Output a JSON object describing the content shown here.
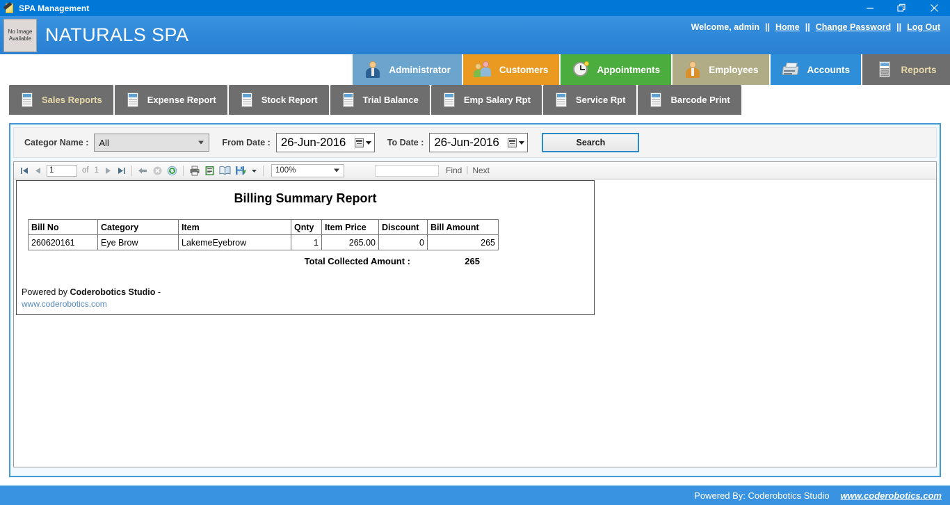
{
  "window": {
    "title": "SPA Management",
    "icon": "notepad-pencil-icon",
    "controls": {
      "minimize": "minimize-icon",
      "restore": "restore-icon",
      "close": "close-icon"
    }
  },
  "header": {
    "logo_placeholder_line1": "No Image",
    "logo_placeholder_line2": "Available",
    "brand": "NATURALS SPA",
    "welcome": "Welcome, admin",
    "sep1": "||",
    "sep2": "||",
    "sep3": "||",
    "links": [
      {
        "label": "Home"
      },
      {
        "label": "Change Password"
      },
      {
        "label": "Log Out"
      }
    ]
  },
  "main_nav": {
    "items": [
      {
        "label": "Administrator",
        "color": "#6ba5cd",
        "icon": "user-suit-icon",
        "active": false
      },
      {
        "label": "Customers",
        "color": "#eb9a21",
        "icon": "people-group-icon",
        "active": false
      },
      {
        "label": "Appointments",
        "color": "#4bad3e",
        "icon": "clock-icon",
        "active": false
      },
      {
        "label": "Employees",
        "color": "#b0ad86",
        "icon": "employee-icon",
        "active": false
      },
      {
        "label": "Accounts",
        "color": "#2f8ed8",
        "icon": "cash-register-icon",
        "active": false
      },
      {
        "label": "Reports",
        "color": "#6e6e6e",
        "icon": "report-doc-icon",
        "active": true
      }
    ],
    "active_text_color": "#e8d9a8"
  },
  "sub_nav": {
    "items": [
      {
        "label": "Sales Reports",
        "icon": "report-doc-icon",
        "active": true
      },
      {
        "label": "Expense Report",
        "icon": "report-doc-icon",
        "active": false
      },
      {
        "label": "Stock Report",
        "icon": "report-doc-icon",
        "active": false
      },
      {
        "label": "Trial Balance",
        "icon": "report-doc-icon",
        "active": false
      },
      {
        "label": "Emp Salary Rpt",
        "icon": "report-doc-icon",
        "active": false
      },
      {
        "label": "Service Rpt",
        "icon": "report-doc-icon",
        "active": false
      },
      {
        "label": "Barcode Print",
        "icon": "report-doc-icon",
        "active": false
      }
    ]
  },
  "filters": {
    "category_label": "Categor Name :",
    "category_value": "All",
    "from_label": "From Date :",
    "from_value": "26-Jun-2016",
    "to_label": "To Date :",
    "to_value": "26-Jun-2016",
    "search_label": "Search",
    "calendar_icon": "calendar-icon"
  },
  "viewer_toolbar": {
    "first_page_icon": "first-page-icon",
    "prev_page_icon": "previous-page-icon",
    "current_page": "1",
    "of_text": "of",
    "total_pages": "1",
    "next_page_icon": "next-page-icon",
    "last_page_icon": "last-page-icon",
    "back_icon": "back-arrow-icon",
    "stop_icon": "stop-icon",
    "refresh_icon": "refresh-icon",
    "print_icon": "print-icon",
    "print_layout_icon": "print-layout-icon",
    "page_setup_icon": "page-setup-icon",
    "export_icon": "export-save-icon",
    "zoom_value": "100%",
    "find_value": "",
    "find_label": "Find",
    "find_separator": "|",
    "next_label": "Next"
  },
  "report": {
    "title": "Billing Summary Report",
    "columns": [
      "Bill No",
      "Category",
      "Item",
      "Qnty",
      "Item Price",
      "Discount",
      "Bill Amount"
    ],
    "rows": [
      {
        "bill_no": "260620161",
        "category": "Eye Brow",
        "item": "LakemeEyebrow",
        "qnty": "1",
        "item_price": "265.00",
        "discount": "0",
        "bill_amount": "265"
      }
    ],
    "total_label": "Total Collected Amount :",
    "total_value": "265",
    "powered_prefix": "Powered by ",
    "powered_company": "Coderobotics Studio",
    "powered_suffix": " -",
    "powered_url": "www.coderobotics.com"
  },
  "footer": {
    "text": "Powered By: Coderobotics Studio",
    "url": "www.coderobotics.com"
  }
}
